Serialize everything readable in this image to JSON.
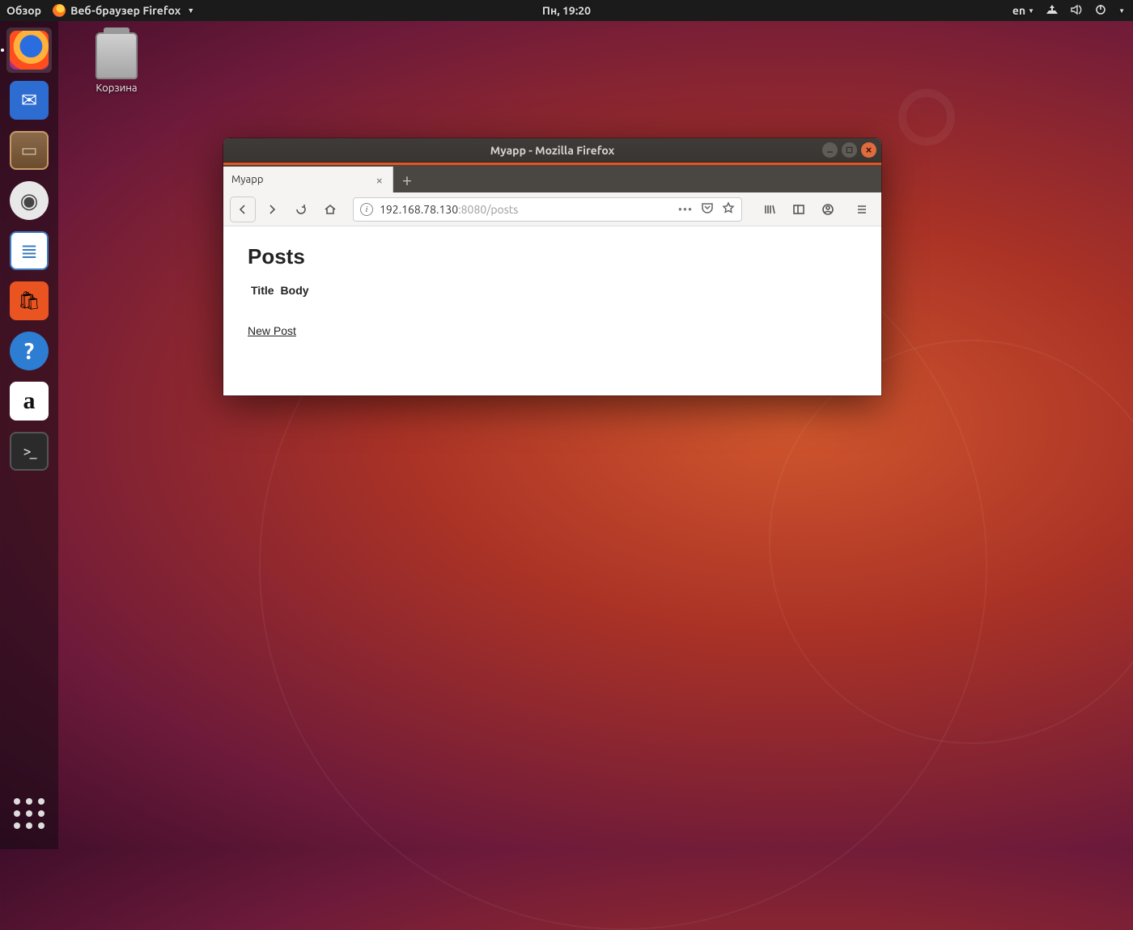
{
  "panel": {
    "activities": "Обзор",
    "appmenu": "Веб-браузер Firefox",
    "clock": "Пн, 19:20",
    "lang": "en"
  },
  "desktop": {
    "trash_label": "Корзина"
  },
  "dock": {
    "items": [
      {
        "name": "firefox"
      },
      {
        "name": "thunderbird"
      },
      {
        "name": "files"
      },
      {
        "name": "rhythmbox"
      },
      {
        "name": "writer"
      },
      {
        "name": "software"
      },
      {
        "name": "help"
      },
      {
        "name": "amazon"
      },
      {
        "name": "terminal"
      }
    ]
  },
  "window": {
    "title": "Myapp - Mozilla Firefox",
    "tab_label": "Myapp",
    "url_host": "192.168.78.130",
    "url_rest": ":8080/posts"
  },
  "page": {
    "heading": "Posts",
    "col1": "Title",
    "col2": "Body",
    "link": "New Post"
  }
}
